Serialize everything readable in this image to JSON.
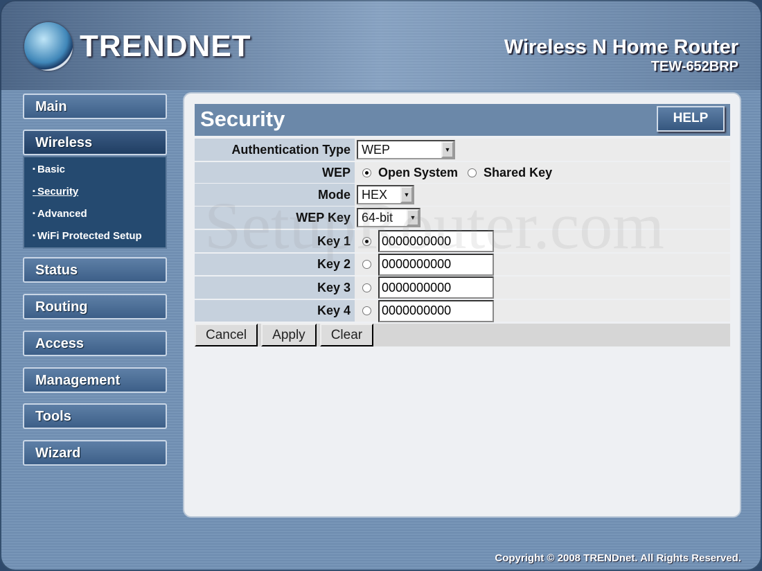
{
  "header": {
    "brand": "TRENDNET",
    "product": "Wireless N Home Router",
    "model": "TEW-652BRP"
  },
  "sidebar": {
    "items": [
      {
        "label": "Main"
      },
      {
        "label": "Wireless"
      },
      {
        "label": "Status"
      },
      {
        "label": "Routing"
      },
      {
        "label": "Access"
      },
      {
        "label": "Management"
      },
      {
        "label": "Tools"
      },
      {
        "label": "Wizard"
      }
    ],
    "wireless_sub": [
      {
        "label": "Basic"
      },
      {
        "label": "Security",
        "current": true
      },
      {
        "label": "Advanced"
      },
      {
        "label": "WiFi Protected Setup"
      }
    ]
  },
  "main": {
    "title": "Security",
    "help": "HELP",
    "auth_label": "Authentication Type",
    "auth_value": "WEP",
    "wep_label": "WEP",
    "wep_options": [
      "Open System",
      "Shared Key"
    ],
    "wep_selected": "Open System",
    "mode_label": "Mode",
    "mode_value": "HEX",
    "wepkey_label": "WEP Key",
    "wepkey_value": "64-bit",
    "keys": [
      {
        "label": "Key 1",
        "value": "0000000000",
        "selected": true
      },
      {
        "label": "Key 2",
        "value": "0000000000"
      },
      {
        "label": "Key 3",
        "value": "0000000000"
      },
      {
        "label": "Key 4",
        "value": "0000000000"
      }
    ],
    "buttons": {
      "cancel": "Cancel",
      "apply": "Apply",
      "clear": "Clear"
    }
  },
  "watermark": "SetupRouter.com",
  "footer": {
    "copyright": "Copyright © 2008 TRENDnet. All Rights Reserved."
  }
}
